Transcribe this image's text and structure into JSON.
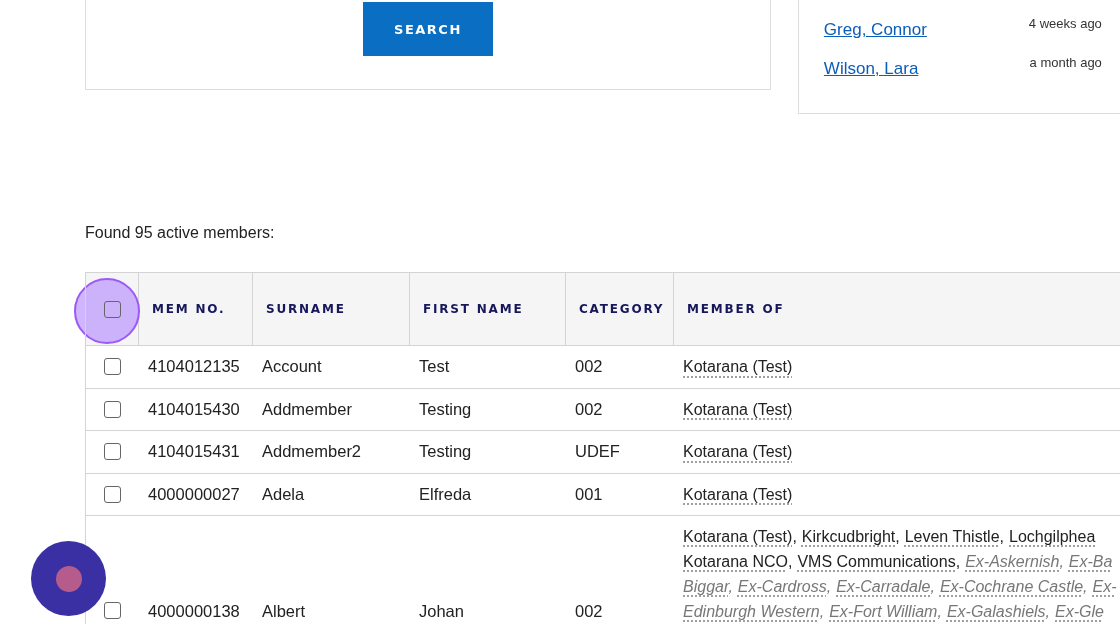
{
  "search_panel": {
    "button": "SEARCH"
  },
  "recent_panel": {
    "items": [
      {
        "name": "Greg, Connor",
        "time": "4 weeks ago"
      },
      {
        "name": "Wilson, Lara",
        "time": "a month ago"
      }
    ]
  },
  "result_summary": "Found 95 active members:",
  "table": {
    "select_all": {
      "checked": false
    },
    "columns": [
      "MEM NO.",
      "SURNAME",
      "FIRST NAME",
      "CATEGORY",
      "MEMBER OF"
    ],
    "rows": [
      {
        "checked": false,
        "mem_no": "4104012135",
        "surname": "Account",
        "first_name": "Test",
        "category": "002",
        "member_of": [
          [
            {
              "name": "Kotarana (Test)",
              "former": false
            }
          ]
        ]
      },
      {
        "checked": false,
        "mem_no": "4104015430",
        "surname": "Addmember",
        "first_name": "Testing",
        "category": "002",
        "member_of": [
          [
            {
              "name": "Kotarana (Test)",
              "former": false
            }
          ]
        ]
      },
      {
        "checked": false,
        "mem_no": "4104015431",
        "surname": "Addmember2",
        "first_name": "Testing",
        "category": "UDEF",
        "member_of": [
          [
            {
              "name": "Kotarana (Test)",
              "former": false
            }
          ]
        ]
      },
      {
        "checked": false,
        "mem_no": "4000000027",
        "surname": "Adela",
        "first_name": "Elfreda",
        "category": "001",
        "member_of": [
          [
            {
              "name": "Kotarana (Test)",
              "former": false
            }
          ]
        ]
      },
      {
        "checked": false,
        "mem_no": "4000000138",
        "surname": "Albert",
        "first_name": "Johan",
        "category": "002",
        "member_of": [
          [
            {
              "name": "Kotarana (Test)",
              "suffix": ",",
              "former": false
            },
            {
              "name": "Kirkcudbright",
              "suffix": ",",
              "former": false
            },
            {
              "name": "Leven Thistle",
              "suffix": ",",
              "former": false
            },
            {
              "name": "Lochgilphea",
              "former": false
            }
          ],
          [
            {
              "name": "Kotarana NCO",
              "suffix": ",",
              "former": false
            },
            {
              "name": "VMS Communications",
              "suffix": ",",
              "former": false
            },
            {
              "name": "Ex-Askernish",
              "suffix": ",",
              "former": true
            },
            {
              "name": "Ex-Ba",
              "former": true
            }
          ],
          [
            {
              "name": "Biggar",
              "suffix": ",",
              "former": true
            },
            {
              "name": "Ex-Cardross",
              "suffix": ",",
              "former": true
            },
            {
              "name": "Ex-Carradale",
              "suffix": ",",
              "former": true
            },
            {
              "name": "Ex-Cochrane Castle",
              "suffix": ",",
              "former": true
            },
            {
              "name": "Ex-",
              "former": true
            }
          ],
          [
            {
              "name": "Edinburgh Western",
              "suffix": ",",
              "former": true
            },
            {
              "name": "Ex-Fort William",
              "suffix": ",",
              "former": true
            },
            {
              "name": "Ex-Galashiels",
              "suffix": ",",
              "former": true
            },
            {
              "name": "Ex-Gle",
              "former": true
            }
          ]
        ]
      }
    ]
  }
}
